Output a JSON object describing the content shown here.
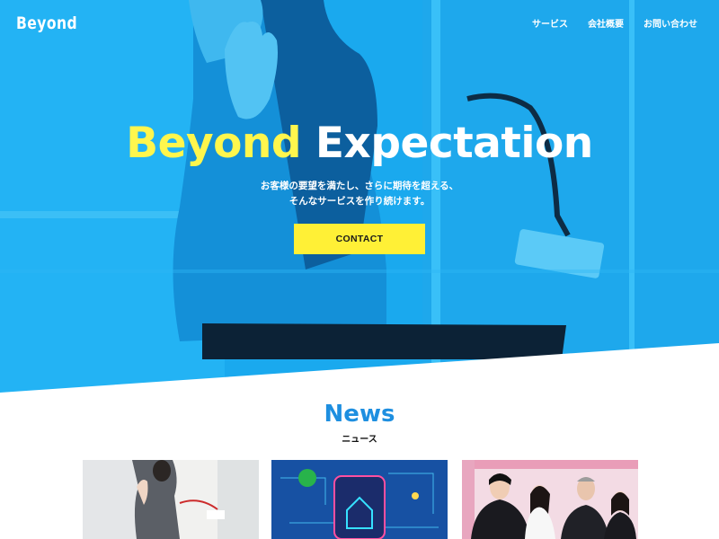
{
  "header": {
    "logo": "Beyond",
    "nav": [
      {
        "label": "サービス"
      },
      {
        "label": "会社概要"
      },
      {
        "label": "お問い合わせ"
      }
    ]
  },
  "hero": {
    "title_accent": "Beyond",
    "title_rest": "Expectation",
    "subtitle_line1": "お客様の要望を満たし、さらに期待を超える、",
    "subtitle_line2": "そんなサービスを作り続けます。",
    "cta_label": "CONTACT",
    "colors": {
      "overlay": "#1aa9ee",
      "accent": "#fff64d",
      "cta": "#fff036"
    }
  },
  "news": {
    "title": "News",
    "subtitle": "ニュース",
    "title_color": "#1e8fe0",
    "cards": [
      {
        "image": "woman-with-microphone-photo"
      },
      {
        "image": "smart-home-circuit-photo"
      },
      {
        "image": "team-thumbs-up-photo"
      }
    ]
  }
}
